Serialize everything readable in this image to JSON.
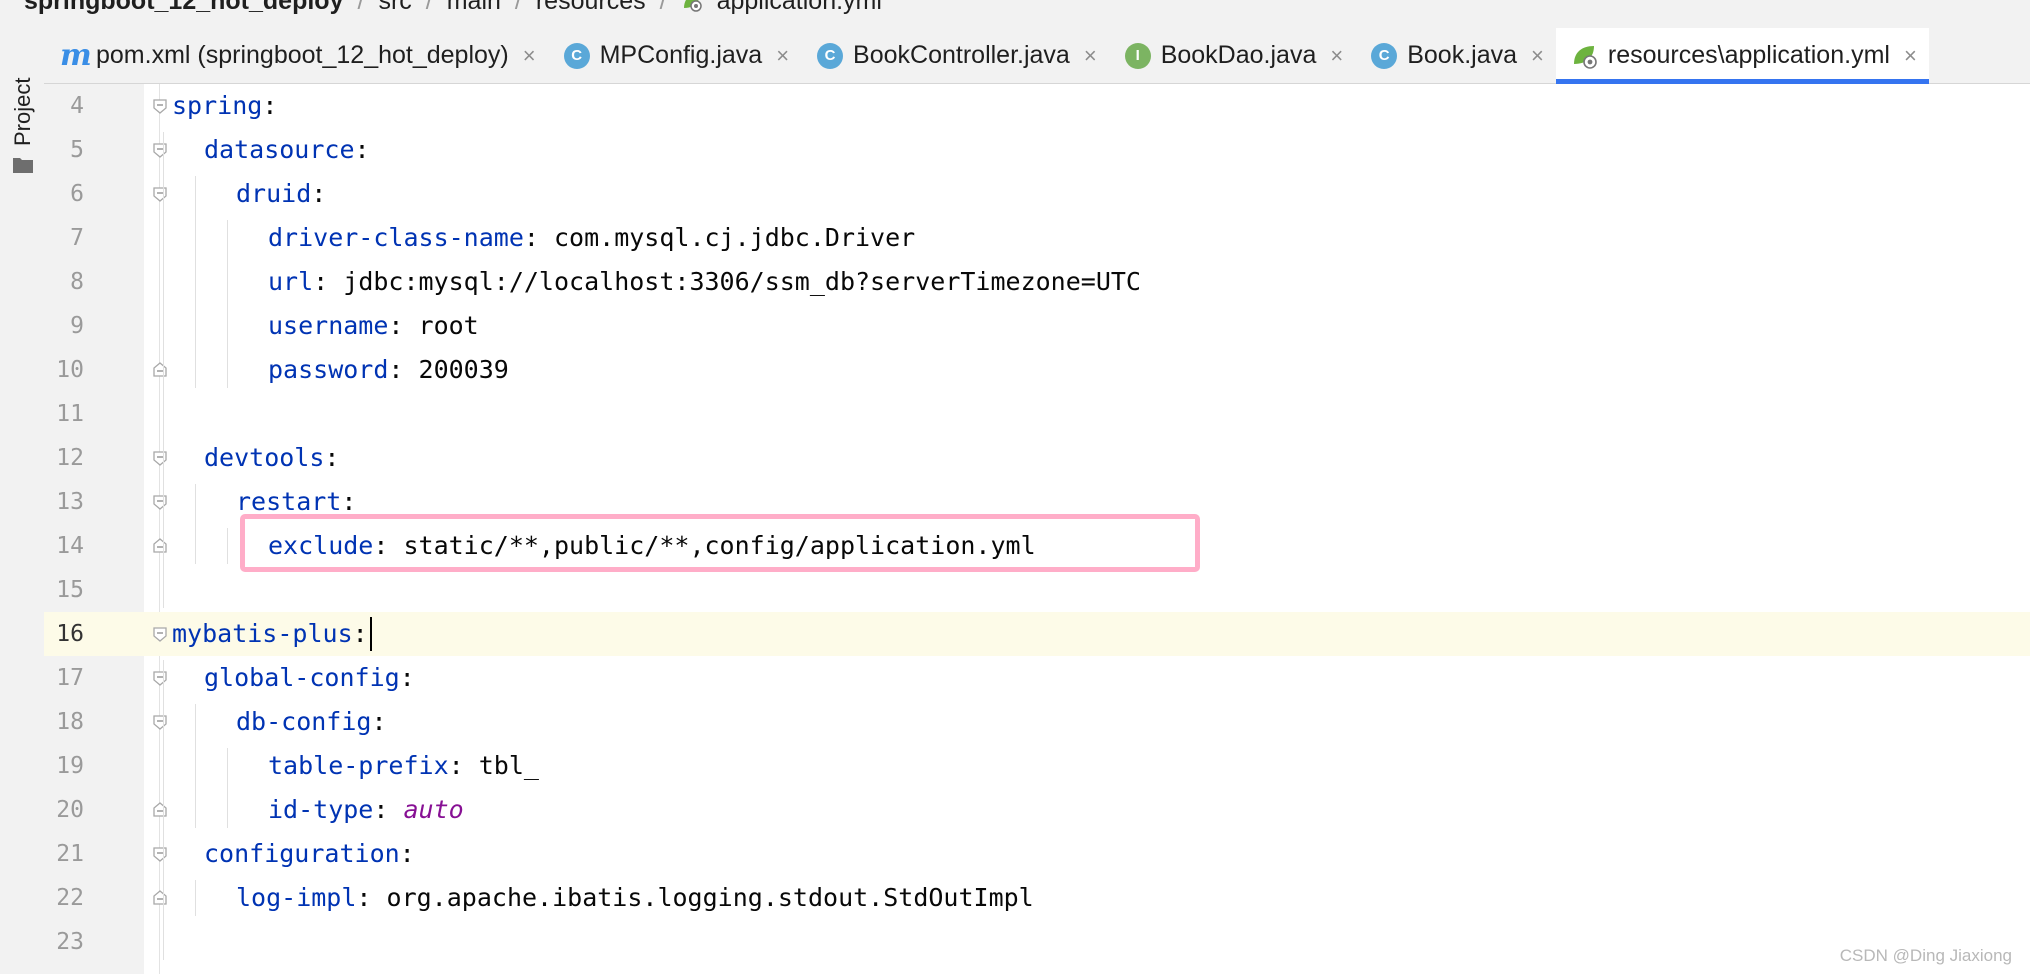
{
  "breadcrumb": {
    "items": [
      "springboot_12_hot_deploy",
      "src",
      "main",
      "resources",
      "application.yml"
    ],
    "separator": "/"
  },
  "tool_window": {
    "project_label": "Project"
  },
  "tabs": [
    {
      "label": "pom.xml (springboot_12_hot_deploy)",
      "icon": "maven-m-icon",
      "active": false
    },
    {
      "label": "MPConfig.java",
      "icon": "class-icon",
      "active": false
    },
    {
      "label": "BookController.java",
      "icon": "class-icon",
      "active": false
    },
    {
      "label": "BookDao.java",
      "icon": "interface-icon",
      "active": false
    },
    {
      "label": "Book.java",
      "icon": "class-icon",
      "active": false
    },
    {
      "label": "resources\\application.yml",
      "icon": "spring-yml-icon",
      "active": true
    }
  ],
  "tab_close_glyph": "×",
  "code": [
    {
      "n": "4",
      "indent": 0,
      "key": "spring",
      "sep": ":",
      "fold": "open"
    },
    {
      "n": "5",
      "indent": 1,
      "key": "datasource",
      "sep": ":",
      "fold": "open"
    },
    {
      "n": "6",
      "indent": 2,
      "key": "druid",
      "sep": ":",
      "fold": "open"
    },
    {
      "n": "7",
      "indent": 3,
      "key": "driver-class-name",
      "sep": ": ",
      "value": "com.mysql.cj.jdbc.Driver"
    },
    {
      "n": "8",
      "indent": 3,
      "key": "url",
      "sep": ": ",
      "value": "jdbc:mysql://localhost:3306/ssm_db?serverTimezone=UTC"
    },
    {
      "n": "9",
      "indent": 3,
      "key": "username",
      "sep": ": ",
      "value": "root"
    },
    {
      "n": "10",
      "indent": 3,
      "key": "password",
      "sep": ": ",
      "value": "200039",
      "fold": "end"
    },
    {
      "n": "11",
      "indent": 0
    },
    {
      "n": "12",
      "indent": 1,
      "key": "devtools",
      "sep": ":",
      "fold": "open"
    },
    {
      "n": "13",
      "indent": 2,
      "key": "restart",
      "sep": ":",
      "fold": "open"
    },
    {
      "n": "14",
      "indent": 3,
      "key": "exclude",
      "sep": ": ",
      "value": "static/**,public/**,config/application.yml",
      "fold": "end"
    },
    {
      "n": "15",
      "indent": 0
    },
    {
      "n": "16",
      "indent": 0,
      "key": "mybatis-plus",
      "sep": ":",
      "fold": "open",
      "current": true
    },
    {
      "n": "17",
      "indent": 1,
      "key": "global-config",
      "sep": ":",
      "fold": "open"
    },
    {
      "n": "18",
      "indent": 2,
      "key": "db-config",
      "sep": ":",
      "fold": "open"
    },
    {
      "n": "19",
      "indent": 3,
      "key": "table-prefix",
      "sep": ": ",
      "value": "tbl_"
    },
    {
      "n": "20",
      "indent": 3,
      "key": "id-type",
      "sep": ": ",
      "enum": "auto",
      "fold": "end"
    },
    {
      "n": "21",
      "indent": 1,
      "key": "configuration",
      "sep": ":",
      "fold": "open"
    },
    {
      "n": "22",
      "indent": 2,
      "key": "log-impl",
      "sep": ": ",
      "value": "org.apache.ibatis.logging.stdout.StdOutImpl",
      "fold": "end"
    },
    {
      "n": "23",
      "indent": 0
    }
  ],
  "watermark": "CSDN @Ding Jiaxiong",
  "colors": {
    "yaml_key": "#0033b3",
    "yaml_enum": "#871094",
    "active_tab_underline": "#3574f0",
    "highlight_box": "#ffadc8",
    "current_line": "#fdfbe8"
  }
}
